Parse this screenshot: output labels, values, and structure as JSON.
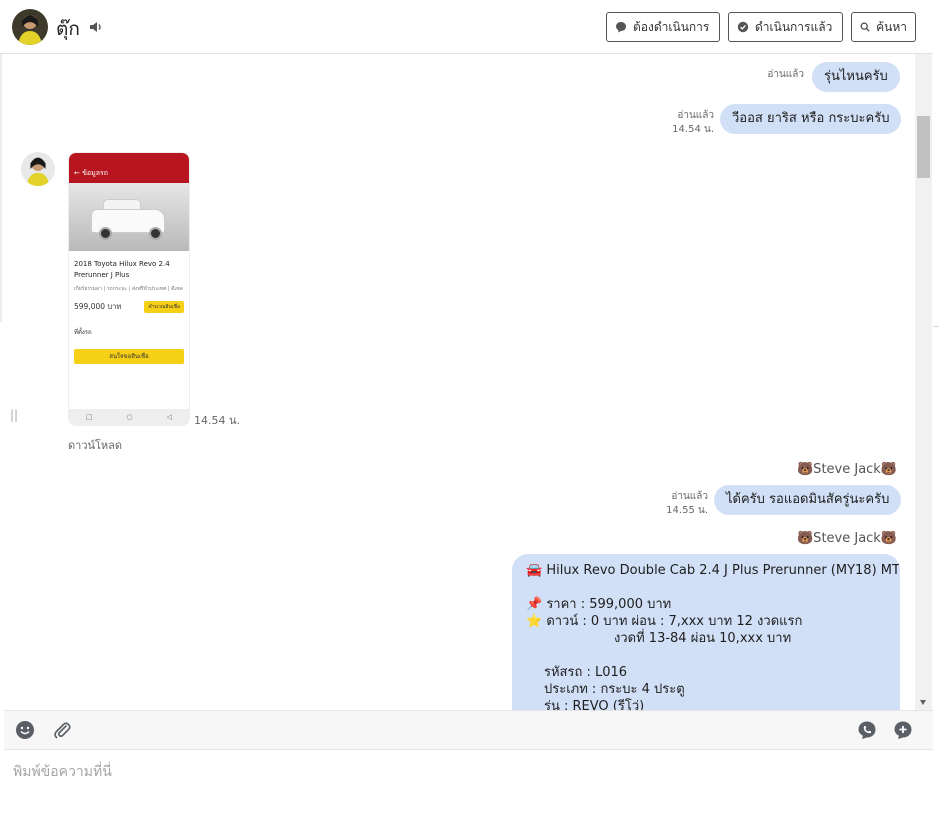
{
  "header": {
    "contact_name": "ตุ๊ก",
    "btn_todo": "ต้องดำเนินการ",
    "btn_done": "ดำเนินการแล้ว",
    "btn_search": "ค้นหา"
  },
  "messages": {
    "m1_text": "รุ่นไหนครับ",
    "m1_read": "อ่านแล้ว",
    "m2_text": "วีออส ยาริส หรือ กระบะครับ",
    "m2_read": "อ่านแล้ว",
    "m2_time": "14.54 น.",
    "img_time": "14.54 น.",
    "download": "ดาวน์โหลด",
    "sender1": "🐻Steve Jack🐻",
    "m3_text": "ได้ครับ รอแอดมินสัครู่นะครับ",
    "m3_read": "อ่านแล้ว",
    "m3_time": "14.55 น.",
    "sender2": "🐻Steve Jack🐻",
    "card": {
      "line1": "🚘 Hilux Revo Double Cab 2.4 J Plus Prerunner (MY18) MT",
      "line2": "📌 ราคา : 599,000 บาท",
      "line3": "⭐ ดาวน์ : 0 บาท ผ่อน : 7,xxx บาท 12 งวดแรก",
      "line4": "งวดที่ 13-84 ผ่อน 10,xxx บาท",
      "line5": "รหัสรถ : L016",
      "line6": "ประเภท : กระบะ 4 ประตู",
      "line7": "รุ่น : REVO (รีโว่)"
    }
  },
  "phone_screenshot": {
    "topbar_label": "ข้อมูลรถ",
    "title": "2018 Toyota Hilux Revo 2.4 Prerunner J Plus",
    "tags": "เกียร์ธรรมดา | รถกระบะ | ส่งฟรีทั่วประเทศ | ดีเซล",
    "price": "599,000 บาท",
    "price_btn": "คำนวณสินเชื่อ",
    "section": "ที่ตั้งรถ",
    "big_btn": "สนใจขอสินเชื่อ"
  },
  "composer": {
    "placeholder": "พิมพ์ข้อความที่นี่"
  }
}
